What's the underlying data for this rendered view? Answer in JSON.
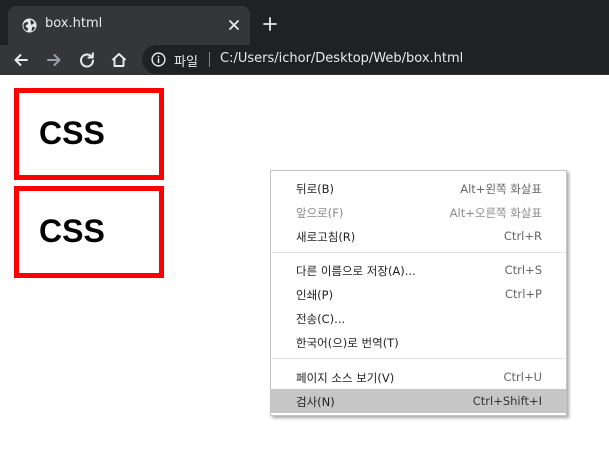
{
  "colors": {
    "tabbar_bg": "#202124",
    "toolbar_bg": "#35363a",
    "box_border": "#ff0000",
    "menu_highlight": "#c6c6c6"
  },
  "tab": {
    "title": "box.html",
    "favicon": "globe-icon"
  },
  "toolbar": {
    "scheme_label": "파일",
    "url": "C:/Users/ichor/Desktop/Web/box.html"
  },
  "page": {
    "boxes": [
      {
        "text": "CSS"
      },
      {
        "text": "CSS"
      }
    ]
  },
  "context_menu": {
    "items": [
      {
        "label": "뒤로(B)",
        "shortcut": "Alt+왼쪽 화살표",
        "enabled": true
      },
      {
        "label": "앞으로(F)",
        "shortcut": "Alt+오른쪽 화살표",
        "enabled": false
      },
      {
        "label": "새로고침(R)",
        "shortcut": "Ctrl+R",
        "enabled": true
      },
      {
        "label": "다른 이름으로 저장(A)...",
        "shortcut": "Ctrl+S",
        "enabled": true
      },
      {
        "label": "인쇄(P)",
        "shortcut": "Ctrl+P",
        "enabled": true
      },
      {
        "label": "전송(C)...",
        "shortcut": "",
        "enabled": true
      },
      {
        "label": "한국어(으)로 번역(T)",
        "shortcut": "",
        "enabled": true
      },
      {
        "label": "페이지 소스 보기(V)",
        "shortcut": "Ctrl+U",
        "enabled": true
      },
      {
        "label": "검사(N)",
        "shortcut": "Ctrl+Shift+I",
        "enabled": true,
        "highlighted": true
      }
    ]
  }
}
